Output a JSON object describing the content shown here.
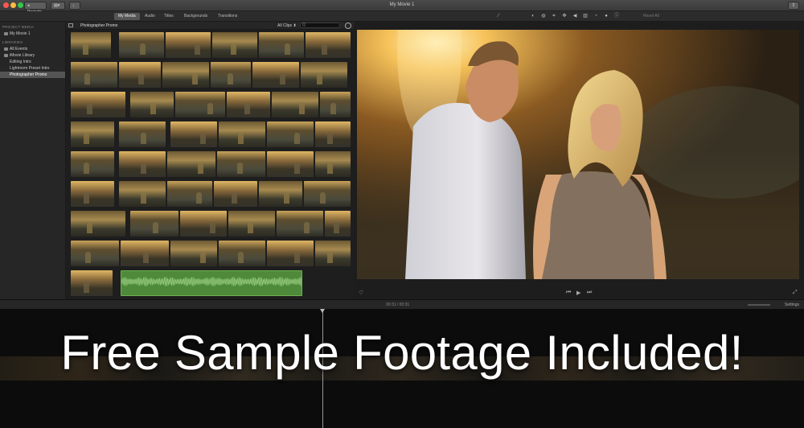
{
  "window": {
    "title": "My Movie 1",
    "projects_button": "◂ Projects",
    "media_button": "▤▾",
    "import_button": "↓",
    "share_icon": "share-icon"
  },
  "toolbar": {
    "tabs": [
      {
        "label": "My Media",
        "active": true
      },
      {
        "label": "Audio",
        "active": false
      },
      {
        "label": "Titles",
        "active": false
      },
      {
        "label": "Backgrounds",
        "active": false
      },
      {
        "label": "Transitions",
        "active": false
      }
    ],
    "reset_all": "Reset All",
    "adjust_icons": [
      "magic-wand-icon",
      "color-balance-icon",
      "color-correction-icon",
      "crop-icon",
      "stabilization-icon",
      "volume-icon",
      "noise-reduction-icon",
      "speed-icon",
      "filter-icon",
      "info-icon"
    ]
  },
  "sidebar": {
    "project_media_header": "PROJECT MEDIA",
    "project_item": "My Movie 1",
    "libraries_header": "LIBRARIES",
    "items": [
      {
        "label": "All Events",
        "selected": false
      },
      {
        "label": "iMovie Library",
        "selected": false
      },
      {
        "label": "Editing Intro",
        "selected": false
      },
      {
        "label": "Lightroom Preset Intro",
        "selected": false
      },
      {
        "label": "Photographer Promo",
        "selected": true
      }
    ]
  },
  "browser": {
    "event_title": "Photographer Promo",
    "filter": "All Clips ⬍",
    "search_placeholder": "Q"
  },
  "timeline": {
    "timecode": "00:31 / 00:31",
    "settings": "Settings"
  },
  "overlay": {
    "text": "Free Sample Footage Included!"
  },
  "colors": {
    "accent_selected": "#545454",
    "audio_clip": "#4e8a3a",
    "overlay_text": "#ffffff"
  }
}
